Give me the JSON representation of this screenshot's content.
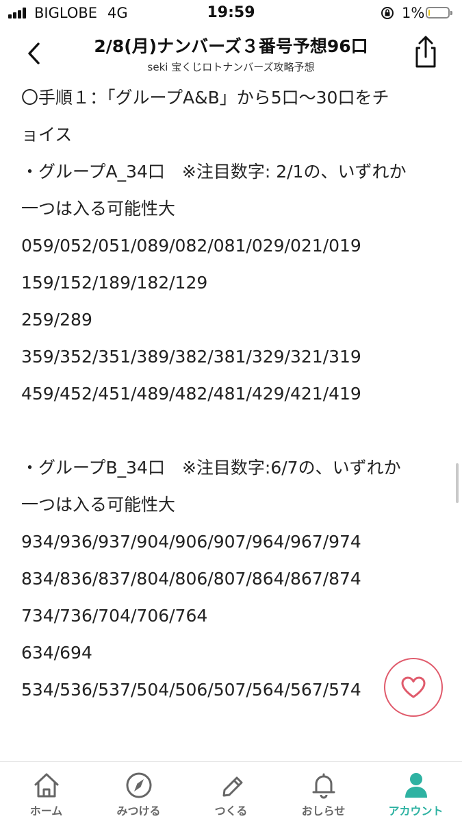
{
  "status_bar": {
    "carrier": "BIGLOBE",
    "network": "4G",
    "time": "19:59",
    "battery_percent": "1%",
    "battery_level": 0.05
  },
  "header": {
    "title": "2/8(月)ナンバーズ３番号予想96口",
    "subtitle": "seki 宝くじロトナンバーズ攻略予想",
    "back_icon": "chevron-left-icon",
    "share_icon": "share-icon"
  },
  "article": {
    "lines": [
      "〇手順１：「グループA&B」から5口〜30口をチ",
      "ョイス",
      "・グループA_34口　※注目数字: 2/1の、いずれか",
      "一つは入る可能性大",
      "059/052/051/089/082/081/029/021/019",
      "159/152/189/182/129",
      "259/289",
      "359/352/351/389/382/381/329/321/319",
      "459/452/451/489/482/481/429/421/419",
      "・グループB_34口　※注目数字:6/7の、いずれか",
      "一つは入る可能性大",
      "934/936/937/904/906/907/964/967/974",
      "834/836/837/804/806/807/864/867/874",
      "734/736/704/706/764",
      "634/694",
      "534/536/537/504/506/507/564/567/574"
    ]
  },
  "like_button": {
    "icon": "heart-icon",
    "color": "#e05b6c"
  },
  "tabbar": {
    "accent": "#2eb2a2",
    "tabs": [
      {
        "label": "ホーム",
        "icon": "home-icon"
      },
      {
        "label": "みつける",
        "icon": "compass-icon"
      },
      {
        "label": "つくる",
        "icon": "pencil-icon"
      },
      {
        "label": "おしらせ",
        "icon": "bell-icon"
      },
      {
        "label": "アカウント",
        "icon": "person-icon",
        "active": true
      }
    ]
  }
}
